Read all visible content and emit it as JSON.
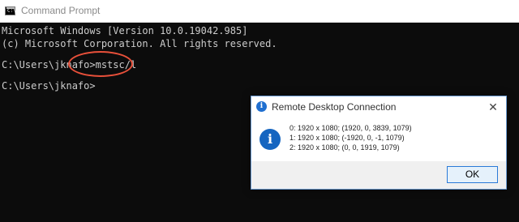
{
  "window": {
    "title": "Command Prompt",
    "icon": "cmd-icon",
    "icon_glyph": "C:\\"
  },
  "console": {
    "lines": [
      "Microsoft Windows [Version 10.0.19042.985]",
      "(c) Microsoft Corporation. All rights reserved.",
      "",
      "C:\\Users\\jknafo>mstsc/l",
      "",
      "C:\\Users\\jknafo>"
    ]
  },
  "dialog": {
    "title": "Remote Desktop Connection",
    "close_label": "✕",
    "info_glyph": "i",
    "messages": [
      "0: 1920 x 1080; (1920, 0, 3839, 1079)",
      "1: 1920 x 1080; (-1920, 0, -1, 1079)",
      "2: 1920 x 1080; (0, 0, 1919, 1079)"
    ],
    "ok_label": "OK"
  },
  "colors": {
    "console_bg": "#0c0c0c",
    "console_text": "#cccccc",
    "highlight": "#e8503a",
    "accent": "#1565c0"
  }
}
